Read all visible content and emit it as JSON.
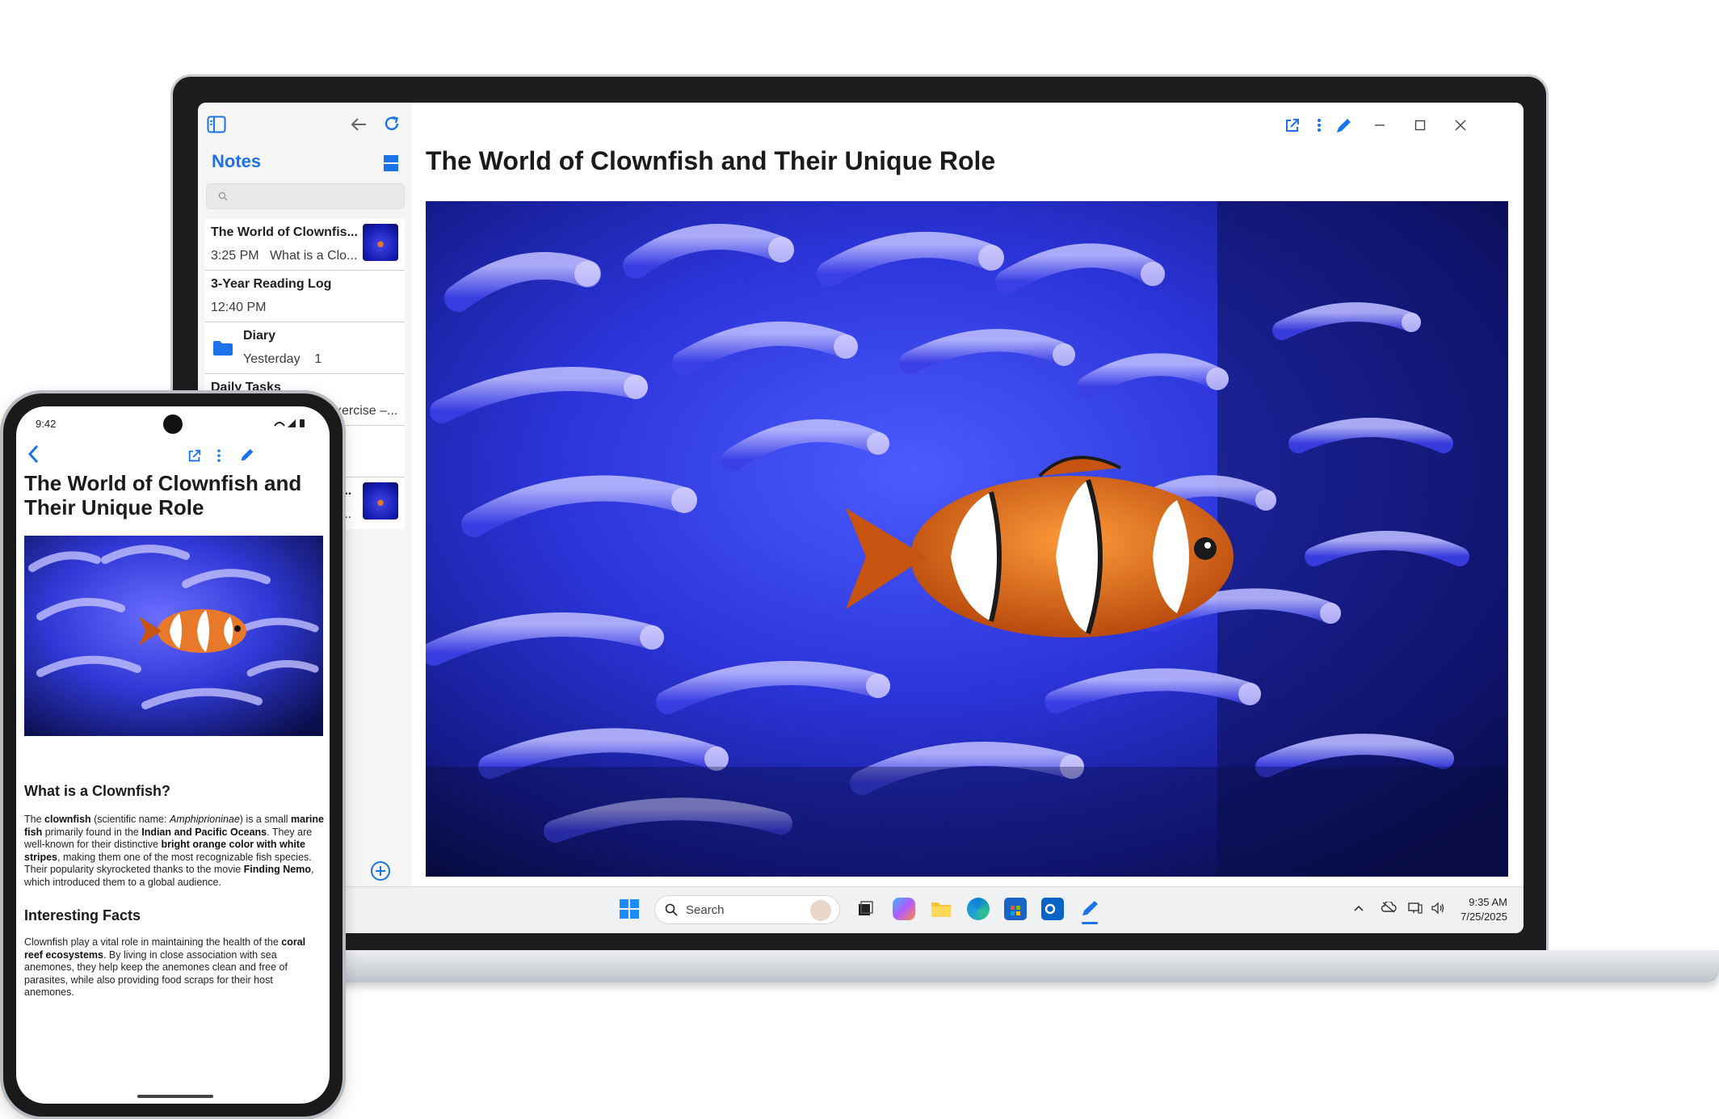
{
  "desktop": {
    "sidebar": {
      "title": "Notes",
      "search": {
        "placeholder": ""
      },
      "items": [
        {
          "title": "The World of Clownfis...",
          "time": "3:25 PM",
          "preview": "What is a Clo...",
          "has_thumbnail": true
        },
        {
          "title": "3-Year Reading Log",
          "time": "12:40 PM",
          "preview": ""
        },
        {
          "title": "Diary",
          "time": "Yesterday",
          "preview": "1",
          "type": "folder"
        },
        {
          "title": "Daily Tasks",
          "time": "",
          "preview": "xercise –..."
        },
        {
          "title": "",
          "time": "",
          "preview": ""
        },
        {
          "title": "s...",
          "time": "",
          "preview": "o...",
          "has_thumbnail": true
        }
      ]
    },
    "note": {
      "title": "The World of Clownfish and Their Unique Role",
      "image_icon": "clownfish-anemone-photo"
    },
    "toolbar_icons": [
      "share-icon",
      "more-icon",
      "edit-pen-icon",
      "minimize-icon",
      "maximize-icon",
      "close-icon"
    ],
    "taskbar": {
      "search_label": "Search",
      "time": "9:35 AM",
      "date": "7/25/2025",
      "apps": [
        "windows-start-icon",
        "task-view-icon",
        "copilot-icon",
        "file-explorer-icon",
        "edge-icon",
        "store-icon",
        "outlook-icon",
        "notes-app-icon"
      ]
    }
  },
  "phone": {
    "status_time": "9:42",
    "title": "The World of Clownfish and Their Unique Role",
    "section1_heading": "What is a Clownfish?",
    "section1": {
      "p1": "The ",
      "b1": "clownfish",
      "p2": " (scientific name: ",
      "i1": "Amphiprioninae",
      "p3": ") is a small ",
      "b2": "marine fish",
      "p4": " primarily found in the ",
      "b3": "Indian and Pacific Oceans",
      "p5": ". They are well-known for their distinctive ",
      "b4": "bright orange color with white stripes",
      "p6": ", making them one of the most recognizable fish species. Their popularity skyrocketed thanks to the movie ",
      "b5": "Finding Nemo",
      "p7": ", which introduced them to a global audience."
    },
    "section2_heading": "Interesting Facts",
    "section2": {
      "p1": "Clownfish play a vital role in maintaining the health of the ",
      "b1": "coral reef ecosystems",
      "p2": ". By living in close association with sea anemones, they help keep the anemones clean and free of parasites, while also providing food scraps for their host anemones."
    }
  },
  "colors": {
    "accent": "#1a73e8",
    "title": "#1b1b1b"
  }
}
